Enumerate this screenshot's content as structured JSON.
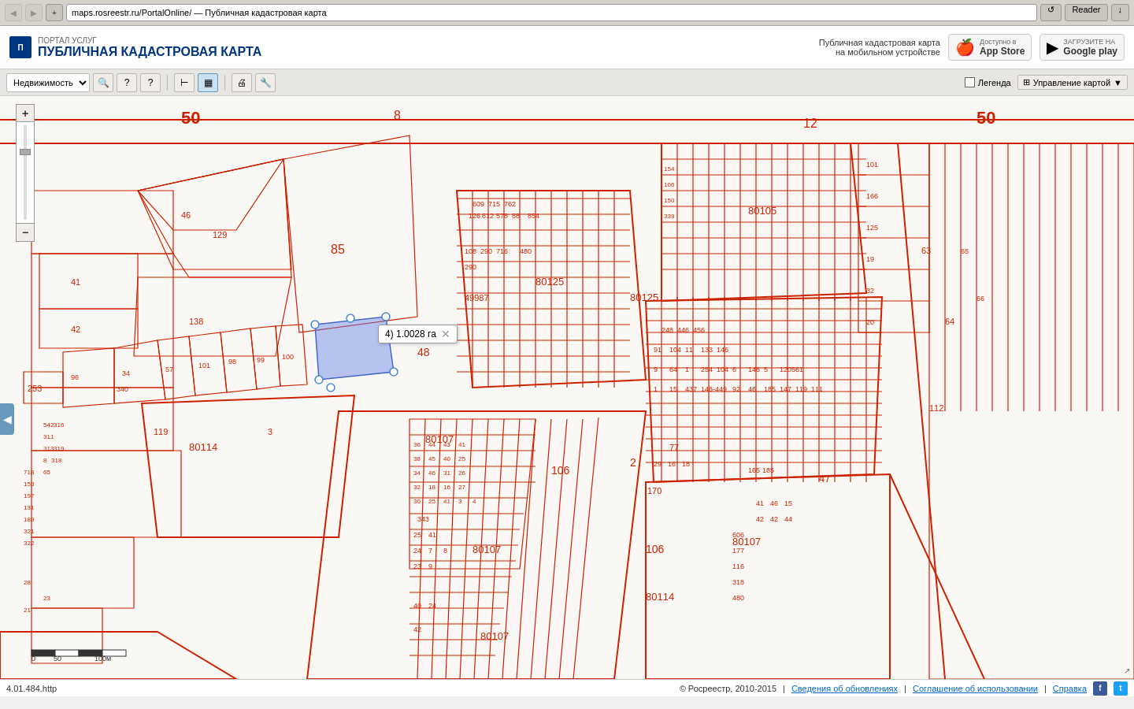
{
  "browser": {
    "back_btn": "◀",
    "forward_btn": "▶",
    "url": "maps.rosreestr.ru/PortalOnline/ — Публичная кадастровая карта",
    "reload_label": "↺",
    "reader_label": "Reader",
    "download_label": "↓"
  },
  "header": {
    "portal_subtitle": "ПОРТАЛ УСЛУГ",
    "portal_title": "ПУБЛИЧНАЯ КАДАСТРОВАЯ КАРТА",
    "mobile_text": "Публичная кадастровая карта\nна мобильном устройстве",
    "appstore_sub": "Доступно в",
    "appstore_name": "App Store",
    "googleplay_sub": "ЗАГРУЗИТЕ НА",
    "googleplay_name": "Google play"
  },
  "toolbar": {
    "property_select": "Недвижимость",
    "btn1_title": "Поиск",
    "btn2_title": "Информация",
    "btn3_title": "Справка",
    "btn4_title": "Измерение расстояния",
    "btn5_title": "Измерение площади",
    "btn6_title": "Печать",
    "btn7_title": "Настройки",
    "legend_label": "Легенда",
    "manage_label": "Управление картой"
  },
  "zoom": {
    "plus": "+",
    "minus": "−"
  },
  "measurement": {
    "text": "4) 1.0028 га",
    "close": "✕"
  },
  "scale": {
    "labels": [
      "0",
      "50",
      "100м"
    ]
  },
  "footer": {
    "version": "4.01.484.http",
    "copyright": "© Росреестр, 2010-2015",
    "separator": "|",
    "link1": "Сведения об обновлениях",
    "link2": "Соглашение об использовании",
    "link3": "Справка"
  }
}
